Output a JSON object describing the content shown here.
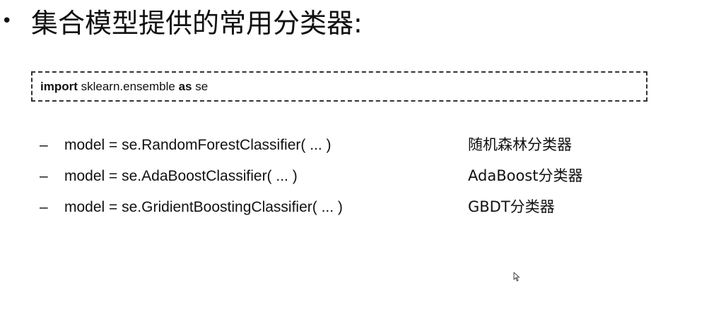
{
  "slide": {
    "bullet": "•",
    "title": "集合模型提供的常用分类器:",
    "code": {
      "kw_import": "import",
      "module": " sklearn.ensemble ",
      "kw_as": "as",
      "alias": " se"
    },
    "items": [
      {
        "dash": "–",
        "code": "model = se.RandomForestClassifier( ... )",
        "desc": "随机森林分类器"
      },
      {
        "dash": "–",
        "code": "model = se.AdaBoostClassifier( ... )",
        "desc": "AdaBoost分类器"
      },
      {
        "dash": "–",
        "code": "model = se.GridientBoostingClassifier( ... )",
        "desc": "GBDT分类器"
      }
    ]
  },
  "icons": {
    "cursor": "mouse-pointer-icon"
  },
  "colors": {
    "text": "#111111",
    "border": "#333333",
    "background": "#ffffff"
  }
}
